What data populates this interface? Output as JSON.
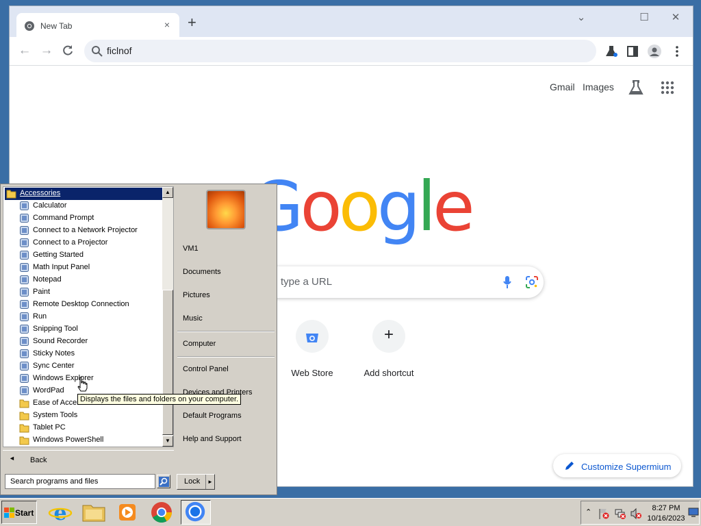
{
  "browser": {
    "tab_title": "New Tab",
    "tab_close": "×",
    "new_tab": "+",
    "minimize": "⌄",
    "maximize": "☐",
    "close": "✕",
    "address_value": "ficlnof"
  },
  "google": {
    "gmail": "Gmail",
    "images": "Images",
    "logo_letters": [
      "G",
      "o",
      "o",
      "g",
      "l",
      "e"
    ],
    "logo_colors": [
      "#4285f4",
      "#ea4335",
      "#fbbc05",
      "#4285f4",
      "#34a853",
      "#ea4335"
    ],
    "search_placeholder": "type a URL",
    "shortcuts": [
      {
        "label": "Web Store"
      },
      {
        "label": "Add shortcut"
      }
    ],
    "customize_label": "Customize Supermium"
  },
  "start_menu": {
    "folder_header": "Accessories",
    "programs": [
      {
        "label": "Calculator",
        "icon": "calculator-icon"
      },
      {
        "label": "Command Prompt",
        "icon": "command-prompt-icon"
      },
      {
        "label": "Connect to a Network Projector",
        "icon": "network-projector-icon"
      },
      {
        "label": "Connect to a Projector",
        "icon": "projector-icon"
      },
      {
        "label": "Getting Started",
        "icon": "getting-started-icon"
      },
      {
        "label": "Math Input Panel",
        "icon": "math-input-icon"
      },
      {
        "label": "Notepad",
        "icon": "notepad-icon"
      },
      {
        "label": "Paint",
        "icon": "paint-icon"
      },
      {
        "label": "Remote Desktop Connection",
        "icon": "remote-desktop-icon"
      },
      {
        "label": "Run",
        "icon": "run-icon"
      },
      {
        "label": "Snipping Tool",
        "icon": "snipping-tool-icon"
      },
      {
        "label": "Sound Recorder",
        "icon": "microphone-icon"
      },
      {
        "label": "Sticky Notes",
        "icon": "sticky-notes-icon"
      },
      {
        "label": "Sync Center",
        "icon": "sync-icon"
      },
      {
        "label": "Windows Explorer",
        "icon": "explorer-icon"
      },
      {
        "label": "WordPad",
        "icon": "wordpad-icon"
      },
      {
        "label": "Ease of Access",
        "icon": "folder-icon"
      },
      {
        "label": "System Tools",
        "icon": "folder-icon"
      },
      {
        "label": "Tablet PC",
        "icon": "folder-icon"
      },
      {
        "label": "Windows PowerShell",
        "icon": "folder-icon"
      }
    ],
    "back_label": "Back",
    "search_placeholder": "Search programs and files",
    "right_links": {
      "user": "VM1",
      "documents": "Documents",
      "pictures": "Pictures",
      "music": "Music",
      "computer": "Computer",
      "control_panel": "Control Panel",
      "devices": "Devices and Printers",
      "default_programs": "Default Programs",
      "help": "Help and Support"
    },
    "lock_label": "Lock",
    "tooltip": "Displays the files and folders on your computer."
  },
  "taskbar": {
    "start_label": "Start",
    "apps": [
      "internet-explorer-icon",
      "file-explorer-icon",
      "media-player-icon",
      "chrome-icon",
      "supermium-icon"
    ],
    "time": "8:27 PM",
    "date": "10/16/2023"
  }
}
